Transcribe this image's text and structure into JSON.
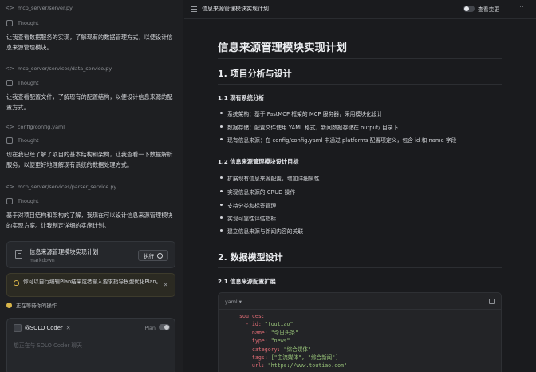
{
  "left": {
    "items": [
      {
        "file": "mcp_server/server.py",
        "thought": "Thought",
        "text": "让我查看数据服务的实现，了解现有的数据管理方式，以便设计信息来源管理模块。"
      },
      {
        "file": "mcp_server/services/data_service.py",
        "thought": "Thought",
        "text": "让我查看配置文件，了解现有的配置结构，以便设计信息来源的配置方式。"
      },
      {
        "file": "config/config.yaml",
        "thought": "Thought",
        "text": "现在我已经了解了项目的基本结构和架构，让我查看一下数据解析服务，以便更好地理解现有系统的数据处理方式。"
      },
      {
        "file": "mcp_server/services/parser_service.py",
        "thought": "Thought",
        "text": "基于对项目结构和架构的了解，我现在可以设计信息来源管理模块的实现方案。让我制定详细的实施计划。"
      }
    ],
    "plan_card": {
      "title": "信息来源管理模块实现计划",
      "sub": "markdown",
      "run": "执行"
    },
    "hint": "你可以自行编辑Plan结果或者输入要求指导模型优化Plan。",
    "waiting": "正在等待你的操作",
    "chat": {
      "agent": "@SOLO Coder",
      "plan": "Plan",
      "placeholder": "想正在与 SOLO Coder 聊天"
    }
  },
  "right": {
    "topbar": {
      "title": "信息来源管理模块实现计划",
      "view_changes": "查看变更"
    },
    "h1": "信息来源管理模块实现计划",
    "s1": "1. 项目分析与设计",
    "s11": "1.1 现有系统分析",
    "b1": [
      "系统架构：基于 FastMCP 框架的 MCP 服务器，采用模块化设计",
      "数据存储：配置文件使用 YAML 格式，新闻数据存储在 output/ 目录下",
      "现有信息来源：在 config/config.yaml 中通过 platforms 配置项定义，包含 id 和 name 字段"
    ],
    "s12": "1.2 信息来源管理模块设计目标",
    "b2": [
      "扩展现有信息来源配置，增加详细属性",
      "实现信息来源的 CRUD 操作",
      "支持分类和标签管理",
      "实现可靠性评估指标",
      "建立信息来源与新闻内容的关联"
    ],
    "s2": "2. 数据模型设计",
    "s21": "2.1 信息来源配置扩展",
    "code": {
      "lang": "yaml",
      "lines": [
        {
          "k": "sources:",
          "v": ""
        },
        {
          "k": "  - id: ",
          "v": "\"toutiao\""
        },
        {
          "k": "    name: ",
          "v": "\"今日头条\""
        },
        {
          "k": "    type: ",
          "v": "\"news\""
        },
        {
          "k": "    category: ",
          "v": "\"综合媒体\""
        },
        {
          "k": "    tags: ",
          "v": "[\"主流媒体\", \"综合新闻\"]"
        },
        {
          "k": "    url: ",
          "v": "\"https://www.toutiao.com\""
        }
      ]
    }
  }
}
